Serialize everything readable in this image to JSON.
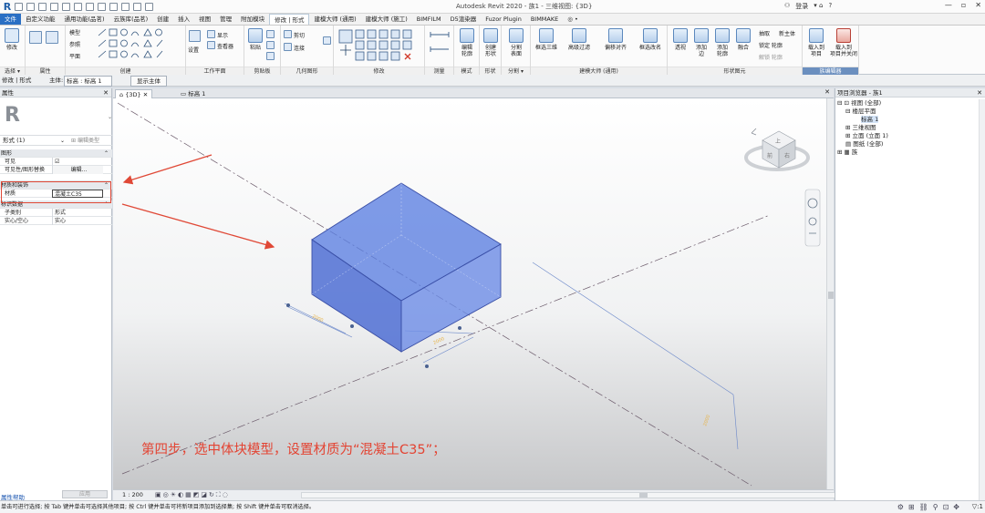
{
  "app": {
    "logo": "R",
    "title": "Autodesk Revit 2020 - 族1 - 三维视图: {3D}",
    "user_label": "登录",
    "help_label": "?"
  },
  "quick_access": [
    "打开",
    "保存",
    "同步",
    "撤消",
    "重做",
    "打印",
    "测量",
    "文字",
    "三维视图",
    "剖面",
    "细线",
    "切换窗口"
  ],
  "ribbon_tabs": [
    {
      "label": "文件",
      "style": "file"
    },
    {
      "label": "自定义功能",
      "style": ""
    },
    {
      "label": "通用功能(品茗)",
      "style": ""
    },
    {
      "label": "云族库(品茗)",
      "style": ""
    },
    {
      "label": "创建",
      "style": ""
    },
    {
      "label": "插入",
      "style": ""
    },
    {
      "label": "视图",
      "style": ""
    },
    {
      "label": "管理",
      "style": ""
    },
    {
      "label": "附加模块",
      "style": ""
    },
    {
      "label": "修改 | 形式",
      "style": "active"
    },
    {
      "label": "建模大师 (通用)",
      "style": ""
    },
    {
      "label": "建模大师 (施工)",
      "style": ""
    },
    {
      "label": "BIMFILM",
      "style": ""
    },
    {
      "label": "D5渲染器",
      "style": ""
    },
    {
      "label": "Fuzor Plugin",
      "style": ""
    },
    {
      "label": "BIMMAKE",
      "style": ""
    },
    {
      "label": "◎ •",
      "style": ""
    }
  ],
  "ribbon": {
    "panels": [
      {
        "label": "选择 ▾"
      },
      {
        "label": "属性"
      },
      {
        "label": "剪贴板"
      },
      {
        "label": "几何图形"
      },
      {
        "label": "修改"
      },
      {
        "label": "测量"
      },
      {
        "label": "创建"
      },
      {
        "label": "工作平面"
      },
      {
        "label": "模式"
      },
      {
        "label": "形状"
      },
      {
        "label": "分割 ▾"
      },
      {
        "label": "建模大师 (通用)"
      },
      {
        "label": "形状图元"
      },
      {
        "label": "族编辑器"
      }
    ],
    "buttons": {
      "modify": "修改",
      "draw_model": "模型",
      "draw_ref": "参照",
      "draw_plane": "平面",
      "set": "设置",
      "show": "显示",
      "viewer": "查看器",
      "paste": "粘贴",
      "cut": "剪切",
      "connect": "连接",
      "edit_profile": "编辑\n轮廓",
      "create_form": "创建\n形状",
      "divide_surface": "分割\n表面",
      "box_3d": "框选三维",
      "hierarchy_filter": "高级过滤",
      "offset_align": "偏移对齐",
      "box_rename": "框选改名",
      "perspective": "透视",
      "add_edge": "添加\n边",
      "add_profile": "添加\n轮廓",
      "dissolve": "融合",
      "extract": "抽取",
      "new_body": "新主体",
      "lock_profile": "锁定 轮廓",
      "unlock_profile": "解锁 轮廓",
      "load_into_project": "载入到\n项目",
      "load_close": "载入到\n项目并关闭"
    }
  },
  "options_bar": {
    "mode": "修改 | 形式",
    "host_label": "主体:",
    "host_value": "标高 : 标高 1",
    "show_host": "显示主体"
  },
  "properties": {
    "title": "属性",
    "type_selector": "形式 (1)",
    "edit_type": "编辑类型",
    "groups": [
      {
        "name": "图形",
        "rows": [
          {
            "key": "可见",
            "value": "☑"
          },
          {
            "key": "可见性/图形替换",
            "value": "编辑..."
          }
        ]
      },
      {
        "name": "材质和装饰",
        "rows": [
          {
            "key": "材质",
            "value": "混凝土C35"
          }
        ]
      },
      {
        "name": "标识数据",
        "rows": [
          {
            "key": "子类别",
            "value": "形式"
          },
          {
            "key": "实心/空心",
            "value": "实心"
          }
        ]
      }
    ],
    "help_link": "属性帮助",
    "apply_button": "应用"
  },
  "view_tabs": [
    {
      "label": "{3D}",
      "active": true
    },
    {
      "label": "标高 1",
      "active": false
    }
  ],
  "viewcube": {
    "top_label": "上",
    "front_label": "前",
    "right_label": "右"
  },
  "canvas": {
    "step_note": "第四步，选中体块模型，设置材质为“混凝土C35”；",
    "box_color": "#5b7fe2",
    "arrow_color": "#e04836"
  },
  "view_control": {
    "scale": "1 : 200"
  },
  "project_browser": {
    "title": "项目浏览器 - 族1",
    "tree": [
      {
        "label": "视图 (全部)",
        "level": 0,
        "toggle": "⊟"
      },
      {
        "label": "楼层平面",
        "level": 1,
        "toggle": "⊟"
      },
      {
        "label": "标高 1",
        "level": 2,
        "toggle": "",
        "selected": true
      },
      {
        "label": "三维视图",
        "level": 1,
        "toggle": "⊞"
      },
      {
        "label": "立面 (立面 1)",
        "level": 1,
        "toggle": "⊞"
      },
      {
        "label": "图纸 (全部)",
        "level": 0,
        "toggle": ""
      },
      {
        "label": "族",
        "level": 0,
        "toggle": "⊞"
      }
    ]
  },
  "status_bar": {
    "message": "单击可进行选择; 按 Tab 键并单击可选择其他项目; 按 Ctrl 键并单击可将新项目添加到选择集; 按 Shift 键并单击可取消选择。",
    "filter": "▽:1"
  }
}
